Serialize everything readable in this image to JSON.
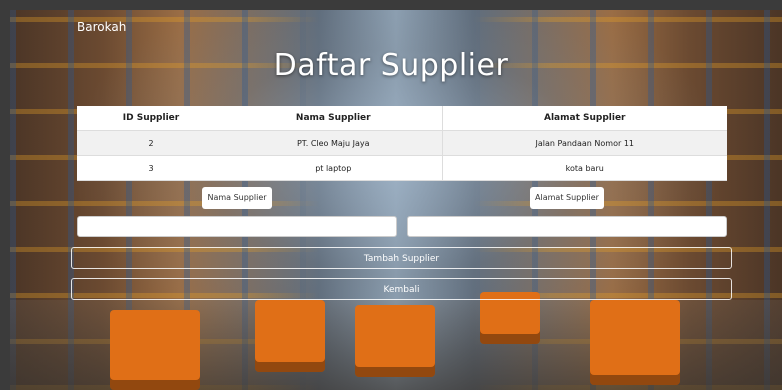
{
  "brand": "Barokah",
  "page_title": "Daftar Supplier",
  "table": {
    "headers": [
      "ID Supplier",
      "Nama Supplier",
      "Alamat Supplier"
    ],
    "rows": [
      [
        "2",
        "PT. Cleo Maju Jaya",
        "Jalan Pandaan Nomor 11"
      ],
      [
        "3",
        "pt laptop",
        "kota baru"
      ]
    ]
  },
  "form": {
    "nama_label": "Nama Supplier",
    "alamat_label": "Alamat Supplier",
    "nama_value": "",
    "alamat_value": ""
  },
  "buttons": {
    "add": "Tambah Supplier",
    "back": "Kembali"
  }
}
